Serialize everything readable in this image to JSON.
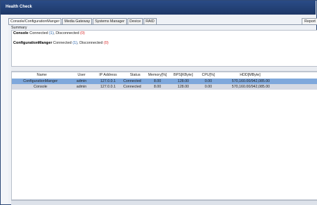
{
  "window": {
    "title": "Health Check"
  },
  "tabs": [
    {
      "label": "Console/ConfigurationManger",
      "active": true
    },
    {
      "label": "Media Gateway",
      "active": false
    },
    {
      "label": "Systems Manager",
      "active": false
    },
    {
      "label": "Device",
      "active": false
    },
    {
      "label": "RAID",
      "active": false
    }
  ],
  "report_button": "Report",
  "summary": {
    "label": "Summary",
    "lines": [
      {
        "name": "Console",
        "connected_text": "Connected",
        "connected_count": "(1)",
        "sep": ", ",
        "disconnected_text": "Disconnected",
        "disconnected_count": "(0)"
      },
      {
        "name": "ConfigurationManger",
        "connected_text": "Connected",
        "connected_count": "(1)",
        "sep": ", ",
        "disconnected_text": "Disconnected",
        "disconnected_count": "(0)"
      }
    ]
  },
  "table": {
    "columns": [
      "Name",
      "User",
      "IP Address",
      "Status",
      "Memory[%]",
      "BPS[KByte]",
      "CPU[%]",
      "HDD[MByte]"
    ],
    "rows": [
      {
        "cells": [
          "ConfigurationManger",
          "admin",
          "127.0.0.1",
          "Connected",
          "8.00",
          "128.00",
          "0.00",
          "570,160.00/942,085.00"
        ],
        "selected": true
      },
      {
        "cells": [
          "Console",
          "admin",
          "127.0.0.1",
          "Connected",
          "8.00",
          "128.00",
          "0.00",
          "570,160.00/942,085.00"
        ],
        "selected": false
      }
    ]
  },
  "colors": {
    "titlebar": "#2a4c87",
    "selected_row": "#7fa8dc",
    "connected": "#1c5aa6",
    "disconnected": "#d62222"
  }
}
